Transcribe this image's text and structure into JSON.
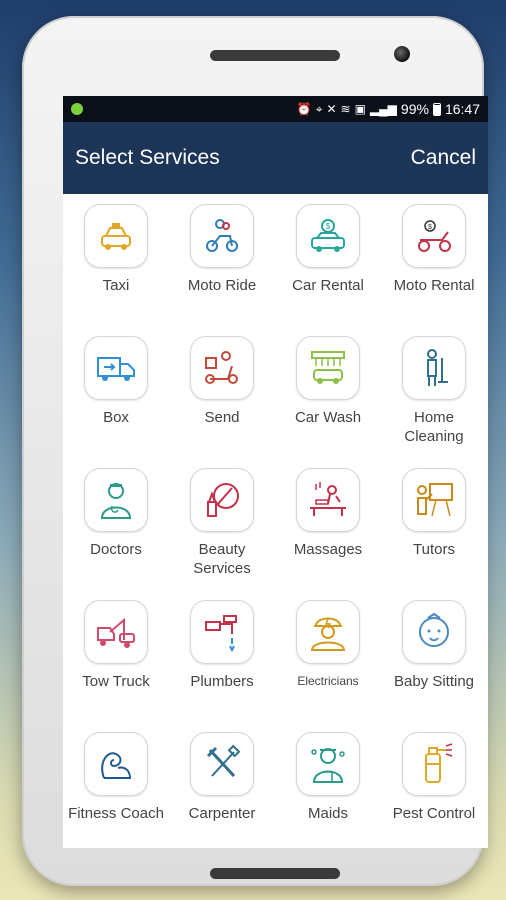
{
  "status_bar": {
    "battery_percent": "99%",
    "time": "16:47"
  },
  "header": {
    "title": "Select Services",
    "cancel_label": "Cancel"
  },
  "services": [
    {
      "label": "Taxi",
      "icon": "taxi-icon",
      "color": "#e0a826"
    },
    {
      "label": "Moto Ride",
      "icon": "moto-ride-icon",
      "color": "#2f7fb5"
    },
    {
      "label": "Car Rental",
      "icon": "car-rental-icon",
      "color": "#2aa59a"
    },
    {
      "label": "Moto Rental",
      "icon": "moto-rental-icon",
      "color": "#c2334a"
    },
    {
      "label": "Box",
      "icon": "box-truck-icon",
      "color": "#2f8fd8"
    },
    {
      "label": "Send",
      "icon": "delivery-scooter-icon",
      "color": "#c24a3a"
    },
    {
      "label": "Car Wash",
      "icon": "car-wash-icon",
      "color": "#8dbf4a"
    },
    {
      "label": "Home Cleaning",
      "icon": "home-cleaning-icon",
      "color": "#2f6f8f"
    },
    {
      "label": "Doctors",
      "icon": "doctor-icon",
      "color": "#2a9a8a"
    },
    {
      "label": "Beauty Services",
      "icon": "beauty-icon",
      "color": "#c2334a"
    },
    {
      "label": "Massages",
      "icon": "massage-icon",
      "color": "#c2334a"
    },
    {
      "label": "Tutors",
      "icon": "tutor-icon",
      "color": "#c98a1a"
    },
    {
      "label": "Tow Truck",
      "icon": "tow-truck-icon",
      "color": "#d04a6a"
    },
    {
      "label": "Plumbers",
      "icon": "plumber-icon",
      "color": "#c2334a"
    },
    {
      "label": "Electricians",
      "icon": "electrician-icon",
      "color": "#d29a1a"
    },
    {
      "label": "Baby Sitting",
      "icon": "baby-icon",
      "color": "#4a8abf"
    },
    {
      "label": "Fitness Coach",
      "icon": "fitness-icon",
      "color": "#1f5a8f"
    },
    {
      "label": "Carpenter",
      "icon": "carpenter-icon",
      "color": "#2f6f8f"
    },
    {
      "label": "Maids",
      "icon": "maid-icon",
      "color": "#2a9a8a"
    },
    {
      "label": "Pest Control",
      "icon": "pest-control-icon",
      "color": "#e0a826"
    }
  ]
}
